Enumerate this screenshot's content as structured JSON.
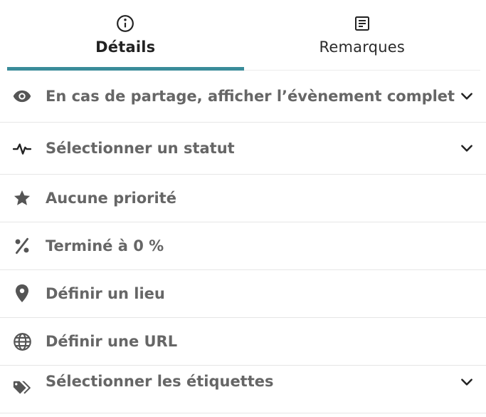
{
  "tabs": [
    {
      "label": "Détails",
      "icon": "info-circle-icon",
      "active": true
    },
    {
      "label": "Remarques",
      "icon": "notes-icon",
      "active": false
    }
  ],
  "rows": [
    {
      "label": "En cas de partage, afficher l’évènement complet",
      "icon": "eye-icon",
      "has_dropdown": true
    },
    {
      "label": "Sélectionner un statut",
      "icon": "pulse-icon",
      "has_dropdown": true
    },
    {
      "label": "Aucune priorité",
      "icon": "star-icon",
      "has_dropdown": false
    },
    {
      "label": "Terminé à 0 %",
      "icon": "percent-icon",
      "has_dropdown": false
    },
    {
      "label": "Définir un lieu",
      "icon": "map-pin-icon",
      "has_dropdown": false
    },
    {
      "label": "Définir une URL",
      "icon": "globe-icon",
      "has_dropdown": false
    },
    {
      "label": "Sélectionner les étiquettes",
      "icon": "tags-icon",
      "has_dropdown": true
    }
  ],
  "colors": {
    "accent": "#3a8c9a",
    "icon": "#555555",
    "text": "#666666",
    "divider": "#e6e6e6"
  }
}
